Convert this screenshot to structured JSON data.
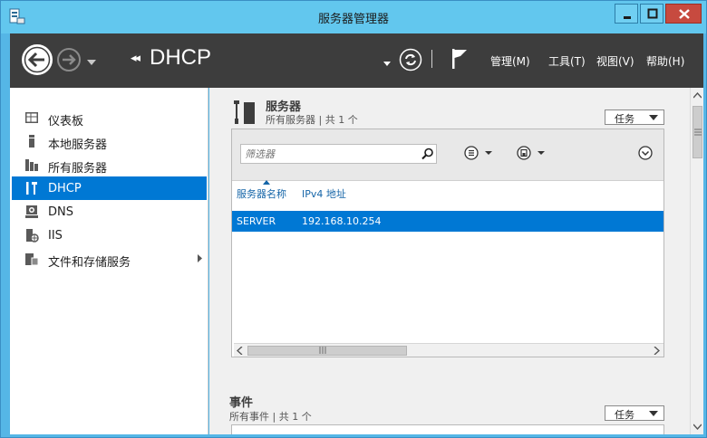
{
  "window": {
    "title": "服务器管理器",
    "controls": [
      "minimize-icon",
      "maximize-icon",
      "close-icon"
    ]
  },
  "toolbar": {
    "breadcrumb_arrows": "◂◂",
    "breadcrumb": "DHCP",
    "menus": [
      "管理(M)",
      "工具(T)",
      "视图(V)",
      "帮助(H)"
    ]
  },
  "sidebar": {
    "items": [
      {
        "label": "仪表板",
        "icon": "dashboard-icon"
      },
      {
        "label": "本地服务器",
        "icon": "local-server-icon"
      },
      {
        "label": "所有服务器",
        "icon": "all-servers-icon"
      },
      {
        "label": "DHCP",
        "icon": "dhcp-icon",
        "selected": true
      },
      {
        "label": "DNS",
        "icon": "dns-icon"
      },
      {
        "label": "IIS",
        "icon": "iis-icon"
      },
      {
        "label": "文件和存储服务",
        "icon": "file-storage-icon",
        "has_submenu": true
      }
    ]
  },
  "servers_section": {
    "title": "服务器",
    "subtitle": "所有服务器 | 共 1 个",
    "tasks_label": "任务",
    "filter_placeholder": "筛选器",
    "columns": [
      "服务器名称",
      "IPv4 地址"
    ],
    "rows": [
      {
        "name": "SERVER",
        "ipv4": "192.168.10.254",
        "selected": true
      }
    ]
  },
  "events_section": {
    "title": "事件",
    "subtitle": "所有事件 | 共 1 个",
    "tasks_label": "任务"
  },
  "colors": {
    "titlebar": "#62c7ee",
    "toolbar": "#3d3d3d",
    "selection": "#0078d4",
    "close_button": "#c74a3f"
  }
}
